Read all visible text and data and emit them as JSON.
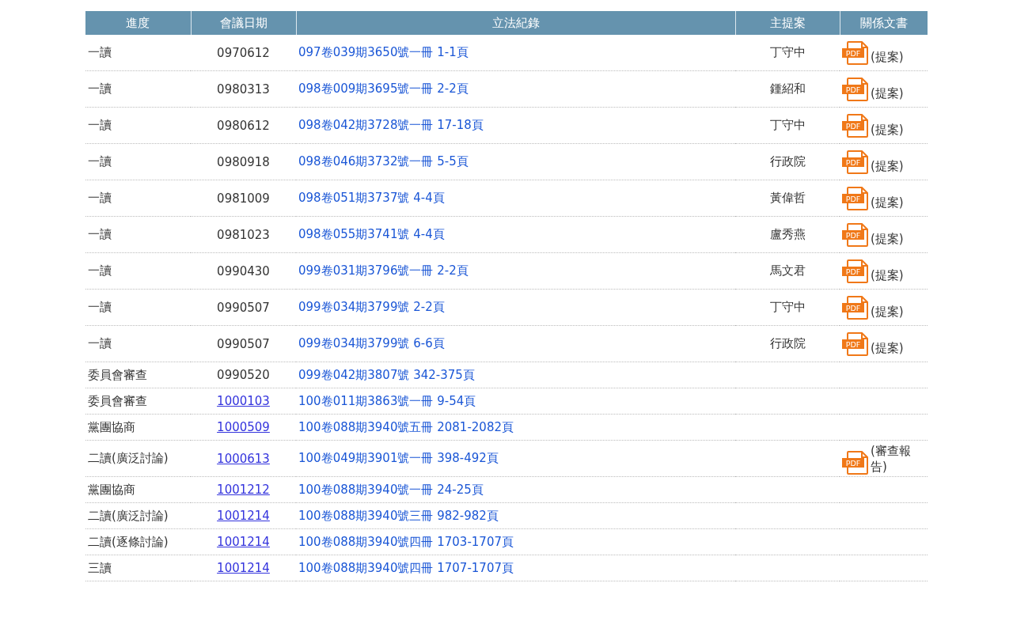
{
  "table": {
    "columns": [
      "進度",
      "會議日期",
      "立法紀錄",
      "主提案",
      "關係文書"
    ],
    "rows": [
      {
        "progress": "一讀",
        "date": "0970612",
        "date_link": false,
        "record": "097卷039期3650號一冊 1-1頁",
        "proposer": "丁守中",
        "document": {
          "icon_text": "PDF",
          "label": "(提案)"
        }
      },
      {
        "progress": "一讀",
        "date": "0980313",
        "date_link": false,
        "record": "098卷009期3695號一冊 2-2頁",
        "proposer": "鍾紹和",
        "document": {
          "icon_text": "PDF",
          "label": "(提案)"
        }
      },
      {
        "progress": "一讀",
        "date": "0980612",
        "date_link": false,
        "record": "098卷042期3728號一冊 17-18頁",
        "proposer": "丁守中",
        "document": {
          "icon_text": "PDF",
          "label": "(提案)"
        }
      },
      {
        "progress": "一讀",
        "date": "0980918",
        "date_link": false,
        "record": "098卷046期3732號一冊 5-5頁",
        "proposer": "行政院",
        "document": {
          "icon_text": "PDF",
          "label": "(提案)"
        }
      },
      {
        "progress": "一讀",
        "date": "0981009",
        "date_link": false,
        "record": "098卷051期3737號 4-4頁",
        "proposer": "黃偉哲",
        "document": {
          "icon_text": "PDF",
          "label": "(提案)"
        }
      },
      {
        "progress": "一讀",
        "date": "0981023",
        "date_link": false,
        "record": "098卷055期3741號 4-4頁",
        "proposer": "盧秀燕",
        "document": {
          "icon_text": "PDF",
          "label": "(提案)"
        }
      },
      {
        "progress": "一讀",
        "date": "0990430",
        "date_link": false,
        "record": "099卷031期3796號一冊 2-2頁",
        "proposer": "馬文君",
        "document": {
          "icon_text": "PDF",
          "label": "(提案)"
        }
      },
      {
        "progress": "一讀",
        "date": "0990507",
        "date_link": false,
        "record": "099卷034期3799號 2-2頁",
        "proposer": "丁守中",
        "document": {
          "icon_text": "PDF",
          "label": "(提案)"
        }
      },
      {
        "progress": "一讀",
        "date": "0990507",
        "date_link": false,
        "record": "099卷034期3799號 6-6頁",
        "proposer": "行政院",
        "document": {
          "icon_text": "PDF",
          "label": "(提案)"
        }
      },
      {
        "progress": "委員會審查",
        "date": "0990520",
        "date_link": false,
        "record": "099卷042期3807號 342-375頁"
      },
      {
        "progress": "委員會審查",
        "date": "1000103",
        "date_link": true,
        "record": "100卷011期3863號一冊 9-54頁"
      },
      {
        "progress": "黨團協商",
        "date": "1000509",
        "date_link": true,
        "record": "100卷088期3940號五冊 2081-2082頁"
      },
      {
        "progress": "二讀(廣泛討論)",
        "date": "1000613",
        "date_link": true,
        "record": "100卷049期3901號一冊 398-492頁",
        "document": {
          "icon_text": "PDF",
          "label": "(審查報告)"
        }
      },
      {
        "progress": "黨團協商",
        "date": "1001212",
        "date_link": true,
        "record": "100卷088期3940號一冊 24-25頁"
      },
      {
        "progress": "二讀(廣泛討論)",
        "date": "1001214",
        "date_link": true,
        "record": "100卷088期3940號三冊 982-982頁"
      },
      {
        "progress": "二讀(逐條討論)",
        "date": "1001214",
        "date_link": true,
        "record": "100卷088期3940號四冊 1703-1707頁"
      },
      {
        "progress": "三讀",
        "date": "1001214",
        "date_link": true,
        "record": "100卷088期3940號四冊 1707-1707頁"
      }
    ]
  }
}
